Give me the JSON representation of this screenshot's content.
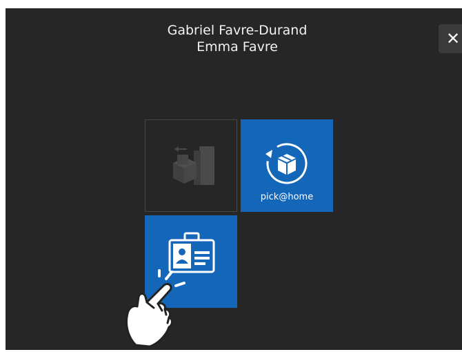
{
  "header": {
    "name_line1": "Gabriel Favre-Durand",
    "name_line2": "Emma Favre"
  },
  "close_button": {
    "icon": "close-icon",
    "label": "✕"
  },
  "tiles": [
    {
      "id": "return-package",
      "icon": "box-return-icon",
      "label": "",
      "enabled": false
    },
    {
      "id": "pick-at-home",
      "icon": "box-cycle-icon",
      "label": "pick@home",
      "enabled": true
    },
    {
      "id": "id-card",
      "icon": "id-card-icon",
      "label": "",
      "enabled": true
    }
  ],
  "pointer": {
    "icon": "hand-pointer-icon"
  },
  "colors": {
    "background": "#262626",
    "tile_active": "#1466b8",
    "text": "#f2f2f2"
  }
}
